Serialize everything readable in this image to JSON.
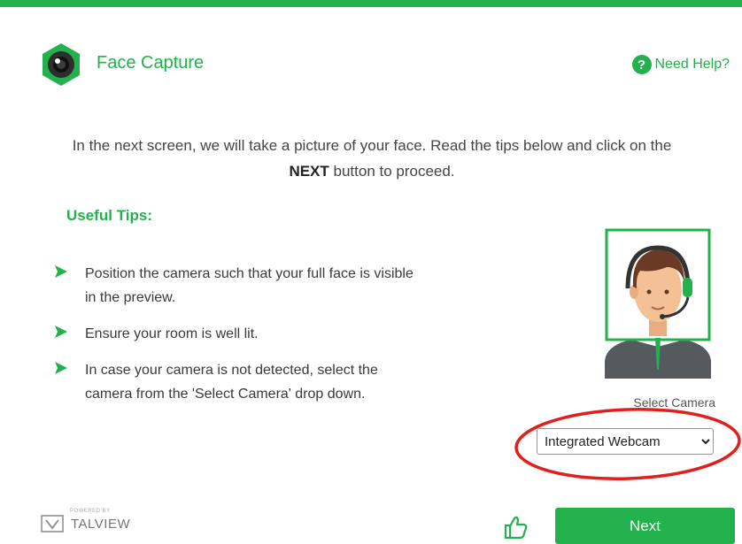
{
  "colors": {
    "accent": "#22b14c",
    "annotation": "#e0201c"
  },
  "header": {
    "title": "Face Capture",
    "logo_icon": "camera-lens-hexagon-icon"
  },
  "help": {
    "label": "Need Help?",
    "icon": "question-circle-icon",
    "icon_glyph": "?"
  },
  "intro": {
    "text_before": "In the next screen, we will take a picture of your face. Read the tips below and click on the ",
    "emphasis": "NEXT",
    "text_after": " button to proceed."
  },
  "tips": {
    "heading": "Useful Tips:",
    "items": [
      "Position the camera such that your full face is visible in the preview.",
      "Ensure your room is well lit.",
      "In case your camera is not detected, select the camera from the 'Select Camera' drop down."
    ]
  },
  "camera": {
    "label": "Select Camera",
    "selected": "Integrated Webcam",
    "options": [
      "Integrated Webcam"
    ]
  },
  "footer": {
    "powered_by": "POWERED BY",
    "brand": "TALVIEW",
    "thumbs_icon": "thumbs-up-icon",
    "next_label": "Next"
  }
}
